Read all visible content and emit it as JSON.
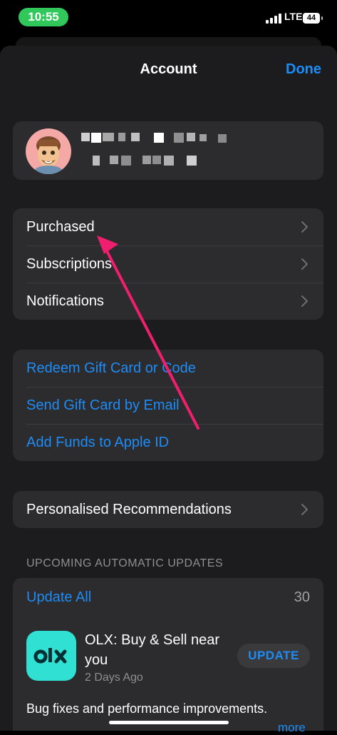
{
  "status_bar": {
    "time": "10:55",
    "network": "LTE",
    "battery": "44"
  },
  "colors": {
    "accent": "#1e8cf6",
    "time_pill": "#30c85b",
    "app_icon": "#2fe0d3",
    "arrow": "#f01e6e"
  },
  "header": {
    "title": "Account",
    "done_label": "Done"
  },
  "profile": {
    "avatar_icon": "memoji-avatar"
  },
  "menu": [
    {
      "label": "Purchased"
    },
    {
      "label": "Subscriptions"
    },
    {
      "label": "Notifications"
    }
  ],
  "links": [
    {
      "label": "Redeem Gift Card or Code"
    },
    {
      "label": "Send Gift Card by Email"
    },
    {
      "label": "Add Funds to Apple ID"
    }
  ],
  "recommendations": {
    "label": "Personalised Recommendations"
  },
  "updates": {
    "section_title": "UPCOMING AUTOMATIC UPDATES",
    "update_all_label": "Update All",
    "count": "30",
    "app": {
      "name": "OLX: Buy & Sell near you",
      "date": "2 Days Ago",
      "button_label": "UPDATE",
      "icon_text": "olx",
      "description": "Bug fixes and performance improvements.",
      "more_label": "more"
    }
  }
}
